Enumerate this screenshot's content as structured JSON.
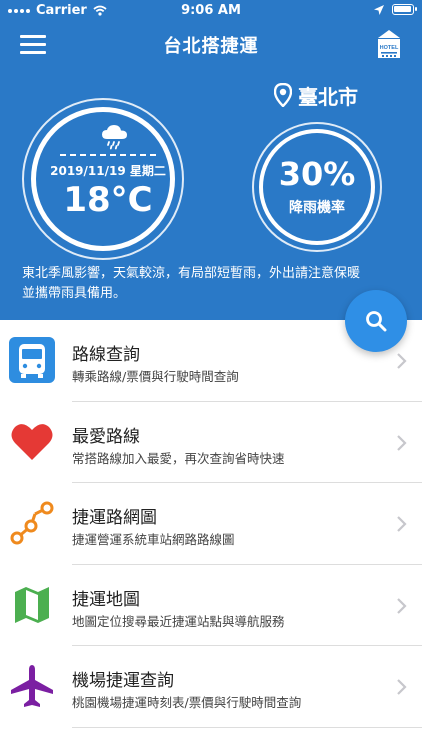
{
  "status_bar": {
    "carrier": "Carrier",
    "time": "9:06 AM"
  },
  "nav": {
    "title": "台北搭捷運",
    "hotel_sign": "HOTEL"
  },
  "weather": {
    "date": "2019/11/19 星期二",
    "temperature": "18°C",
    "location": "臺北市",
    "rain_chance": "30%",
    "rain_label": "降雨機率",
    "forecast_line1": "東北季風影響，天氣較涼，有局部短暫雨，外出請注意保暖",
    "forecast_line2": "並攜帶雨具備用。"
  },
  "colors": {
    "header_bg": "#2a79c7",
    "fab": "#2f8fe6",
    "route_icon": "#2e8de0",
    "heart": "#e53935",
    "network": "#ef8a1e",
    "map": "#4caf50",
    "plane": "#7b1fa2"
  },
  "menu": [
    {
      "icon": "bus-icon",
      "title": "路線查詢",
      "subtitle": "轉乘路線/票價與行駛時間查詢"
    },
    {
      "icon": "heart-icon",
      "title": "最愛路線",
      "subtitle": "常搭路線加入最愛，再次查詢省時快速"
    },
    {
      "icon": "network-icon",
      "title": "捷運路網圖",
      "subtitle": "捷運營運系統車站網路路線圖"
    },
    {
      "icon": "map-icon",
      "title": "捷運地圖",
      "subtitle": "地圖定位搜尋最近捷運站點與導航服務"
    },
    {
      "icon": "airplane-icon",
      "title": "機場捷運查詢",
      "subtitle": "桃園機場捷運時刻表/票價與行駛時間查詢"
    }
  ]
}
